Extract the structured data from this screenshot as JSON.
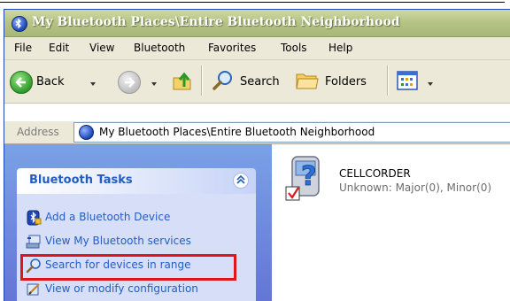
{
  "window": {
    "title": "My Bluetooth Places\\Entire Bluetooth Neighborhood"
  },
  "menubar": {
    "items": [
      "File",
      "Edit",
      "View",
      "Bluetooth",
      "Favorites",
      "Tools",
      "Help"
    ]
  },
  "toolbar": {
    "back_label": "Back",
    "search_label": "Search",
    "folders_label": "Folders"
  },
  "address": {
    "label": "Address",
    "value": "My Bluetooth Places\\Entire Bluetooth Neighborhood"
  },
  "taskpane": {
    "title": "Bluetooth Tasks",
    "tasks": [
      {
        "label": "Add a Bluetooth Device",
        "icon": "bluetooth-device-icon"
      },
      {
        "label": "View My Bluetooth services",
        "icon": "services-icon"
      },
      {
        "label": "Search for devices in range",
        "icon": "search-icon",
        "highlighted": true
      },
      {
        "label": "View or modify configuration",
        "icon": "configuration-icon"
      }
    ]
  },
  "devices": [
    {
      "name": "CELLCORDER",
      "status": "Unknown: Major(0), Minor(0)",
      "icon": "unknown-device-icon"
    }
  ],
  "colors": {
    "highlight_box": "#e0151b",
    "task_link": "#215dc6",
    "taskpane_bg": "#6375d6"
  }
}
